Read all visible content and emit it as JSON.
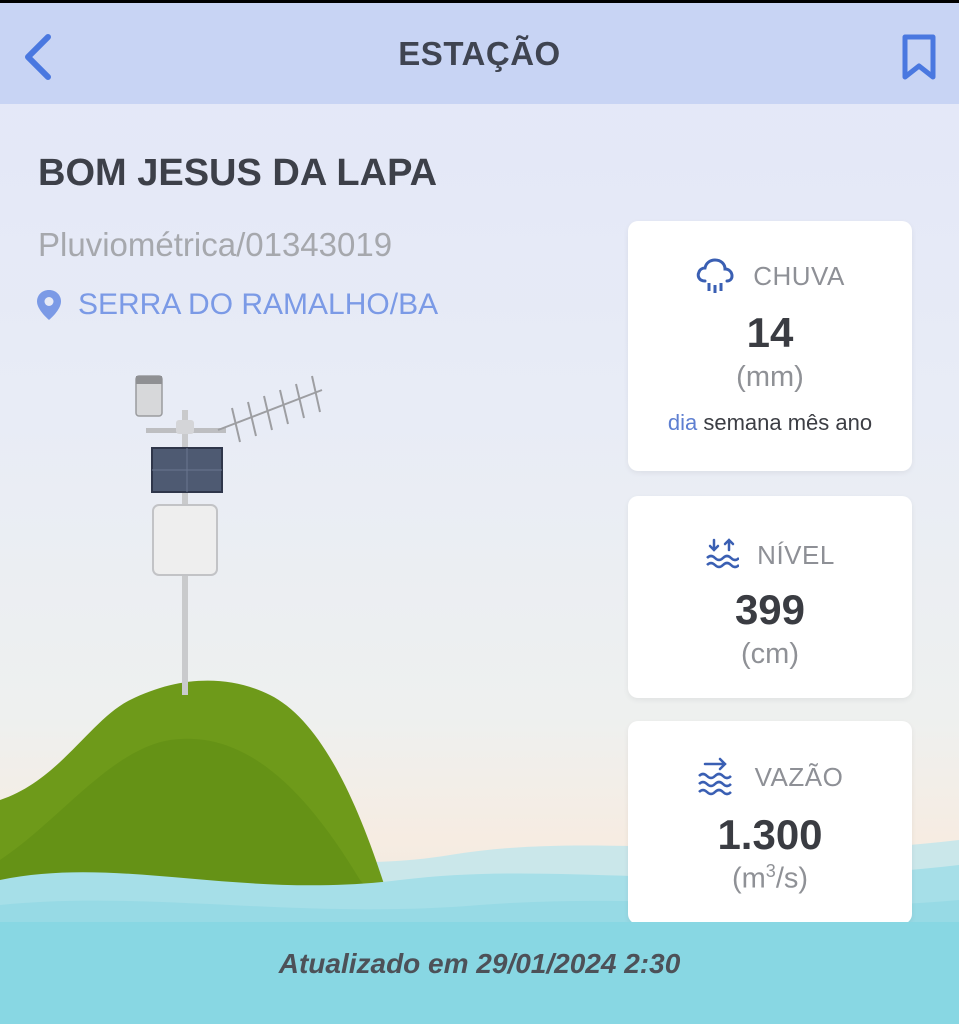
{
  "header": {
    "title": "ESTAÇÃO",
    "back_icon": "chevron-left-icon",
    "bookmark_icon": "bookmark-icon",
    "accent_color": "#4a78e0"
  },
  "station": {
    "name": "BOM JESUS DA LAPA",
    "type_code": "Pluviométrica/01343019",
    "location": "SERRA DO RAMALHO/BA",
    "location_icon": "map-pin-icon"
  },
  "cards": {
    "rain": {
      "icon": "rain-cloud-icon",
      "label": "CHUVA",
      "value": "14",
      "unit": "(mm)",
      "periods": {
        "day": "dia",
        "week": "semana",
        "month": "mês",
        "year": "ano",
        "active": "dia"
      }
    },
    "level": {
      "icon": "water-level-icon",
      "label": "NÍVEL",
      "value": "399",
      "unit": "(cm)"
    },
    "flow": {
      "icon": "water-flow-icon",
      "label": "VAZÃO",
      "value": "1.300",
      "unit_prefix": "(m",
      "unit_sup": "3",
      "unit_suffix": "/s)"
    }
  },
  "footer": {
    "updated": "Atualizado em 29/01/2024 2:30"
  }
}
